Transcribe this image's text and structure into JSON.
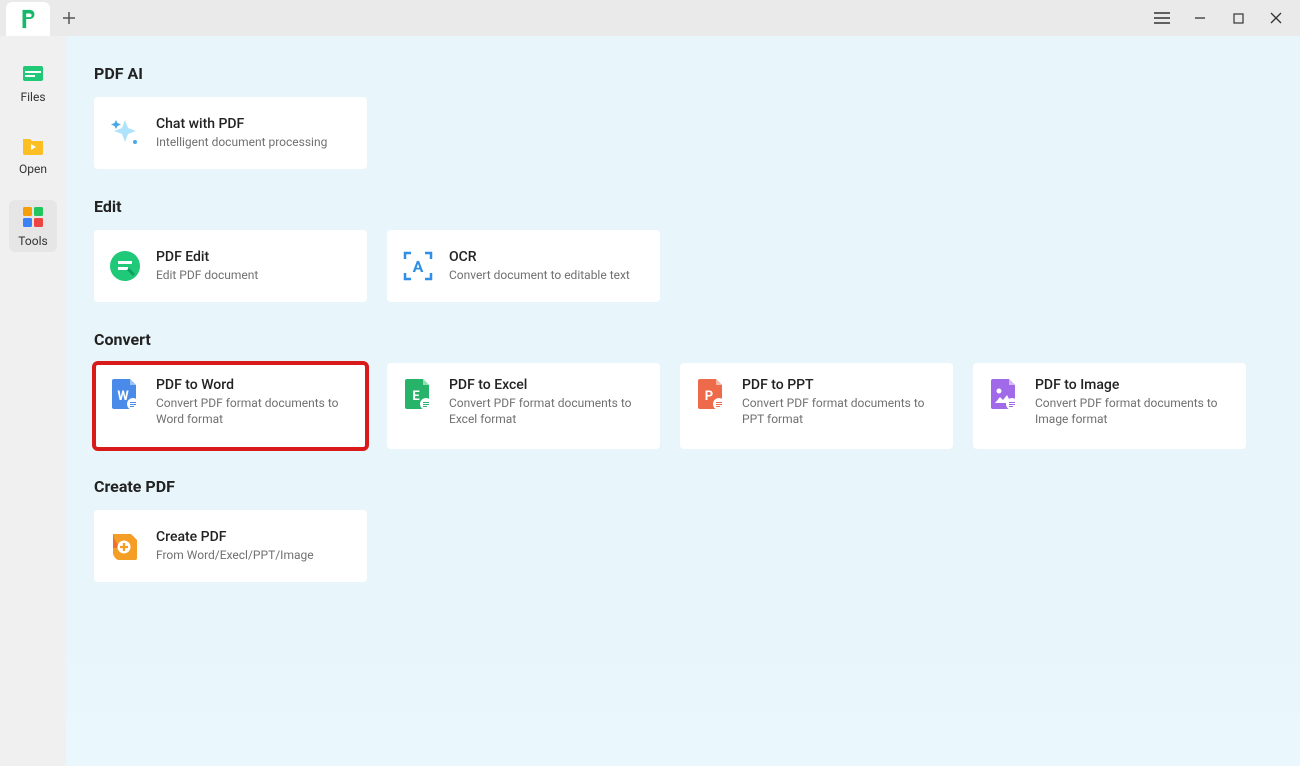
{
  "sidebar": {
    "items": [
      {
        "label": "Files"
      },
      {
        "label": "Open"
      },
      {
        "label": "Tools"
      }
    ]
  },
  "sections": {
    "pdf_ai": {
      "title": "PDF AI",
      "card": {
        "title": "Chat with PDF",
        "desc": "Intelligent document processing"
      }
    },
    "edit": {
      "title": "Edit",
      "cards": [
        {
          "title": "PDF Edit",
          "desc": "Edit PDF document"
        },
        {
          "title": "OCR",
          "desc": "Convert document to editable text"
        }
      ]
    },
    "convert": {
      "title": "Convert",
      "cards": [
        {
          "title": "PDF to Word",
          "desc": "Convert PDF format documents to Word format"
        },
        {
          "title": "PDF to Excel",
          "desc": "Convert PDF format documents to Excel format"
        },
        {
          "title": "PDF to PPT",
          "desc": "Convert PDF format documents to PPT format"
        },
        {
          "title": "PDF to Image",
          "desc": "Convert PDF format documents to Image format"
        }
      ]
    },
    "create": {
      "title": "Create PDF",
      "card": {
        "title": "Create PDF",
        "desc": "From Word/Execl/PPT/Image"
      }
    }
  }
}
